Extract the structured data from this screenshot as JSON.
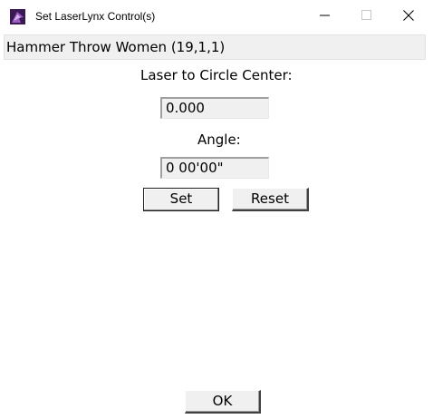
{
  "window": {
    "title": "Set LaserLynx Control(s)",
    "icon": "laserlynx-app-icon",
    "controls": {
      "minimize_icon": "minimize-icon",
      "maximize_icon": "maximize-icon",
      "close_icon": "close-icon"
    }
  },
  "event": {
    "name": "Hammer Throw Women (19,1,1)"
  },
  "laser": {
    "label": "Laser to Circle Center:",
    "value": "0.000"
  },
  "angle": {
    "label": "Angle:",
    "value": "0 00'00\""
  },
  "buttons": {
    "set": "Set",
    "reset": "Reset",
    "ok": "OK"
  },
  "colors": {
    "background": "#ffffff",
    "panel": "#f0f0f0",
    "icon_purple": "#5a2a7a"
  }
}
